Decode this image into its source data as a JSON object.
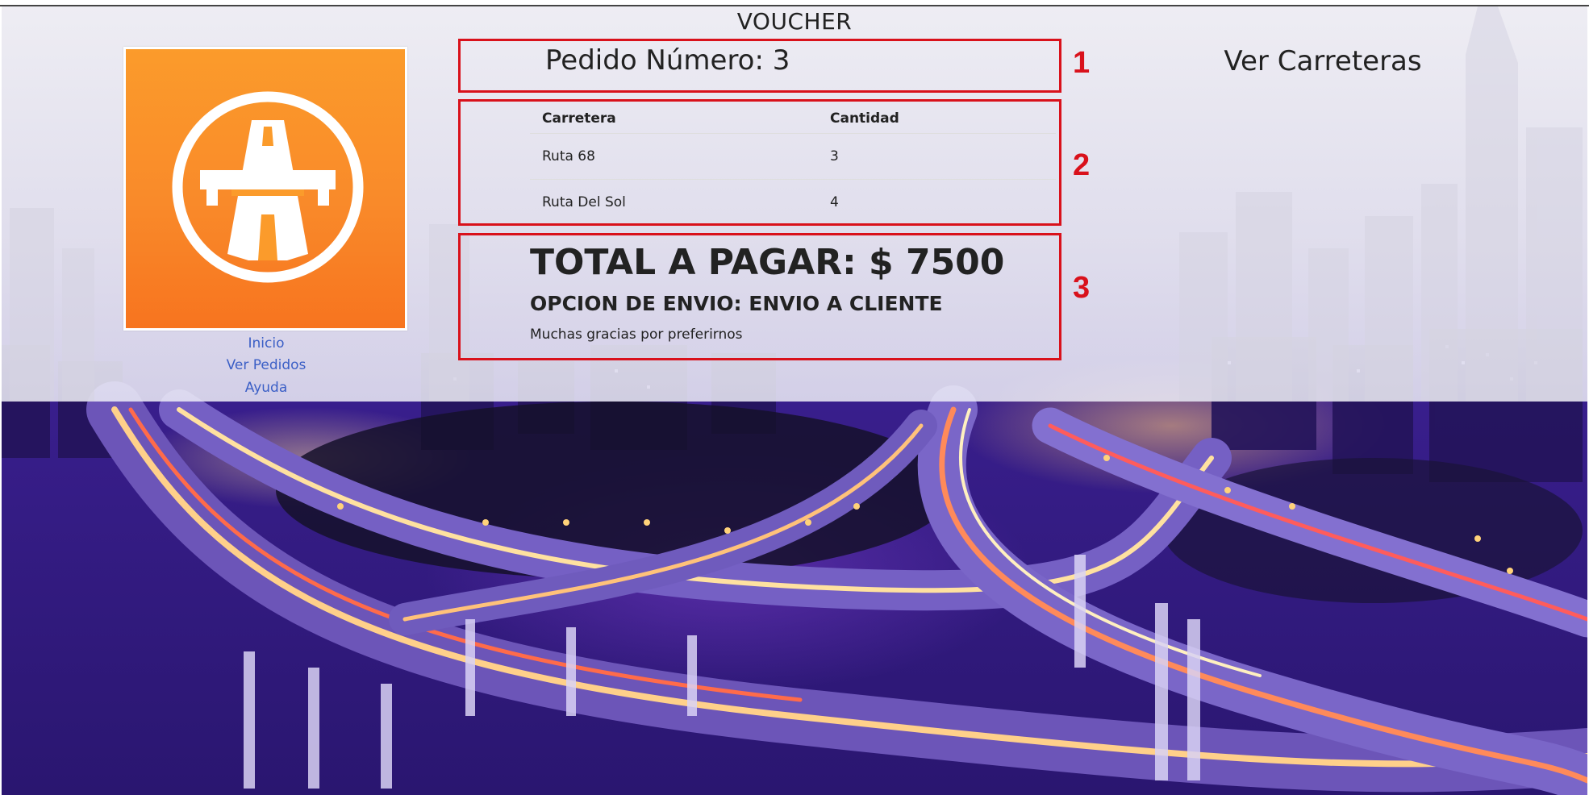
{
  "header": {
    "title": "VOUCHER"
  },
  "logo": {
    "icon": "highway-icon",
    "bg_color": "#f98a2a"
  },
  "nav": {
    "items": [
      {
        "label": "Inicio"
      },
      {
        "label": "Ver Pedidos"
      },
      {
        "label": "Ayuda"
      }
    ]
  },
  "annotations": {
    "labels": [
      "1",
      "2",
      "3"
    ],
    "color": "#d9111b"
  },
  "order": {
    "number_label": "Pedido Número: 3",
    "table": {
      "headers": [
        "Carretera",
        "Cantidad"
      ],
      "rows": [
        [
          "Ruta 68",
          "3"
        ],
        [
          "Ruta Del Sol",
          "4"
        ]
      ]
    },
    "total": "TOTAL A PAGAR: $ 7500",
    "shipping": "OPCION DE ENVIO: ENVIO A CLIENTE",
    "thanks": "Muchas gracias por preferirnos"
  },
  "sidebar_right": {
    "link": "Ver Carreteras"
  }
}
